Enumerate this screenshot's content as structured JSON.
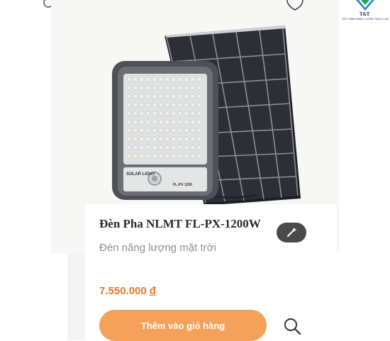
{
  "product": {
    "name": "Đèn Pha NLMT FL-PX-1200W",
    "subtitle": "Đèn năng lượng mặt trời",
    "price": "7.550.000",
    "currency": "đ",
    "panel_label": "SOLAR LIGHT",
    "model_label": "FL-PX 1200"
  },
  "actions": {
    "add_to_cart": "Thêm vào giỏ hàng"
  },
  "logo": {
    "brand": "T&T",
    "tagline": "TIẾT KIỆM NĂNG LƯỢNG SẠCH CUỘC SỐNG XANH"
  },
  "icons": {
    "wishlist": "heart-icon",
    "quick_view": "search-icon",
    "ai_edit": "magic-wand-icon"
  },
  "colors": {
    "accent": "#f5a15a",
    "price": "#e8762c",
    "text": "#2a2a2a",
    "muted": "#8f8f8f"
  }
}
